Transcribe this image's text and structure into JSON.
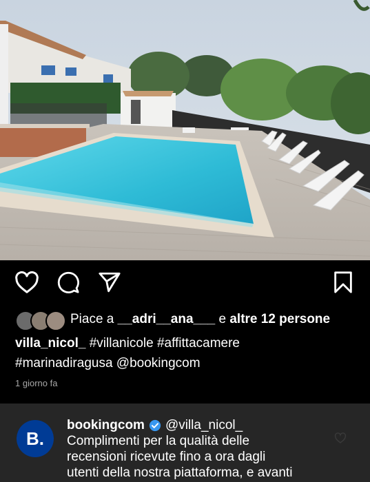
{
  "post": {
    "likes": {
      "prefix": "Piace a",
      "user": "__adri__ana___",
      "joiner": "e",
      "others": "altre 12 persone"
    },
    "caption": {
      "username": "villa_nicol_",
      "line1": "#villanicole #affittacamere",
      "line2": "#marinadiragusa @bookingcom"
    },
    "timestamp": "1 giorno fa"
  },
  "icons": {
    "like": "heart-icon",
    "comment": "comment-icon",
    "share": "send-icon",
    "save": "bookmark-icon",
    "verified": "verified-badge-icon"
  },
  "comment": {
    "avatar_letter": "B.",
    "username": "bookingcom",
    "mention": "@villa_nicol_",
    "lines": [
      "Complimenti per la qualità delle",
      "recensioni ricevute fino a ora dagli",
      "utenti della nostra piattaforma, e avanti"
    ]
  },
  "colors": {
    "background": "#000000",
    "comment_background": "#262626",
    "booking_blue": "#003b95",
    "verified_blue": "#3897f0",
    "muted_text": "#a8a8a8",
    "pool_water": "#3fc6dc"
  }
}
